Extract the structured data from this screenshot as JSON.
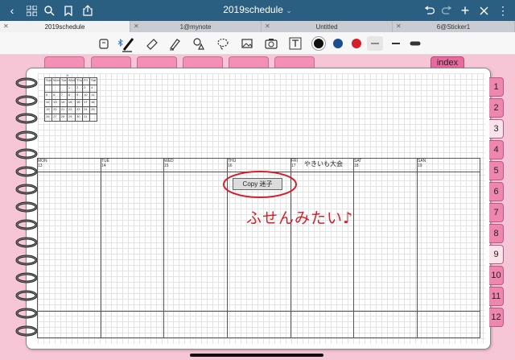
{
  "navbar": {
    "title": "2019schedule",
    "title_caret": "⌄"
  },
  "tabs": [
    {
      "label": "2019schedule",
      "active": true
    },
    {
      "label": "1@mynote",
      "active": false
    },
    {
      "label": "Untitled",
      "active": false
    },
    {
      "label": "6@Sticker1",
      "active": false
    }
  ],
  "colors": {
    "navbar": "#2b5f82",
    "accent_pink": "#f48fb6",
    "ink_black": "#111111",
    "ink_blue": "#1d4f8f",
    "ink_red": "#d61e2a"
  },
  "index_tab": "index",
  "month_tabs": [
    "1",
    "2",
    "3",
    "4",
    "5",
    "6",
    "7",
    "8",
    "9",
    "10",
    "11",
    "12"
  ],
  "mini_calendar": {
    "title": "5",
    "headers": [
      "Sun",
      "Mon",
      "Tue",
      "Wed",
      "Thu",
      "Fri",
      "Sat"
    ],
    "weeks": [
      [
        "",
        "",
        "",
        "1",
        "2",
        "3",
        "4"
      ],
      [
        "5",
        "6",
        "7",
        "8",
        "9",
        "10",
        "11"
      ],
      [
        "12",
        "13",
        "14",
        "15",
        "16",
        "17",
        "18"
      ],
      [
        "19",
        "20",
        "21",
        "22",
        "23",
        "24",
        "25"
      ],
      [
        "26",
        "27",
        "28",
        "29",
        "30",
        "31",
        ""
      ]
    ]
  },
  "week": {
    "days": [
      {
        "name": "MON",
        "date": "13"
      },
      {
        "name": "TUE",
        "date": "14"
      },
      {
        "name": "WED",
        "date": "15"
      },
      {
        "name": "THU",
        "date": "16"
      },
      {
        "name": "FRI",
        "date": "17"
      },
      {
        "name": "SAT",
        "date": "18"
      },
      {
        "name": "SAN",
        "date": "19"
      }
    ],
    "fri_note": "やきいも大会"
  },
  "sticky_note": "Copy 迷子",
  "handwriting": "ふせんみたい♪"
}
